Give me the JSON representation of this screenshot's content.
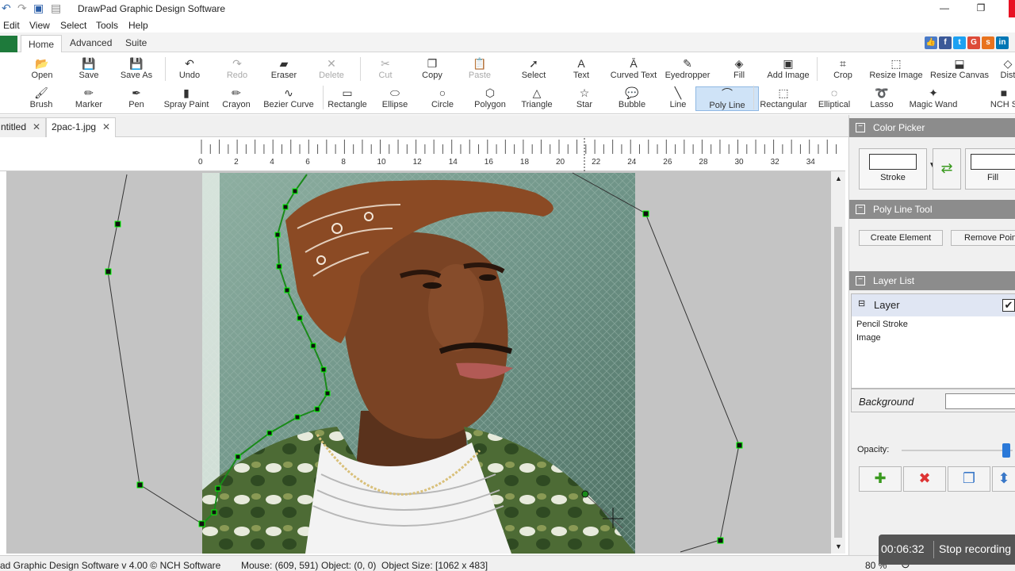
{
  "window": {
    "title": "DrawPad Graphic Design Software"
  },
  "menu": [
    "Edit",
    "View",
    "Select",
    "Tools",
    "Help"
  ],
  "ribbon_tabs": [
    "Home",
    "Advanced",
    "Suite"
  ],
  "tools_row1": [
    {
      "label": "Open",
      "icon": "folder-icon"
    },
    {
      "label": "Save",
      "icon": "save-icon"
    },
    {
      "label": "Save As",
      "icon": "save-as-icon"
    },
    {
      "label": "Undo",
      "icon": "undo-icon"
    },
    {
      "label": "Redo",
      "icon": "redo-icon"
    },
    {
      "label": "Eraser",
      "icon": "eraser-icon"
    },
    {
      "label": "Delete",
      "icon": "delete-icon"
    },
    {
      "label": "Cut",
      "icon": "cut-icon"
    },
    {
      "label": "Copy",
      "icon": "copy-icon"
    },
    {
      "label": "Paste",
      "icon": "paste-icon"
    },
    {
      "label": "Select",
      "icon": "cursor-icon"
    },
    {
      "label": "Text",
      "icon": "text-icon"
    },
    {
      "label": "Curved Text",
      "icon": "curved-text-icon"
    },
    {
      "label": "Eyedropper",
      "icon": "eyedropper-icon"
    },
    {
      "label": "Fill",
      "icon": "fill-icon"
    },
    {
      "label": "Add Image",
      "icon": "add-image-icon"
    },
    {
      "label": "Crop",
      "icon": "crop-icon"
    },
    {
      "label": "Resize Image",
      "icon": "resize-image-icon"
    },
    {
      "label": "Resize Canvas",
      "icon": "resize-canvas-icon"
    },
    {
      "label": "Dist",
      "icon": "distort-icon"
    }
  ],
  "tools_row2": [
    {
      "label": "Brush",
      "icon": "brush-icon"
    },
    {
      "label": "Marker",
      "icon": "marker-icon"
    },
    {
      "label": "Pen",
      "icon": "pen-icon"
    },
    {
      "label": "Spray Paint",
      "icon": "spray-paint-icon"
    },
    {
      "label": "Crayon",
      "icon": "crayon-icon"
    },
    {
      "label": "Bezier Curve",
      "icon": "bezier-icon"
    },
    {
      "label": "Rectangle",
      "icon": "rectangle-icon"
    },
    {
      "label": "Ellipse",
      "icon": "ellipse-icon"
    },
    {
      "label": "Circle",
      "icon": "circle-icon"
    },
    {
      "label": "Polygon",
      "icon": "polygon-icon"
    },
    {
      "label": "Triangle",
      "icon": "triangle-icon"
    },
    {
      "label": "Star",
      "icon": "star-icon"
    },
    {
      "label": "Bubble",
      "icon": "bubble-icon"
    },
    {
      "label": "Line",
      "icon": "line-icon"
    },
    {
      "label": "Poly Line",
      "icon": "polyline-icon"
    },
    {
      "label": "Rectangular",
      "icon": "rect-select-icon"
    },
    {
      "label": "Elliptical",
      "icon": "ellipse-select-icon"
    },
    {
      "label": "Lasso",
      "icon": "lasso-icon"
    },
    {
      "label": "Magic Wand",
      "icon": "magic-wand-icon"
    },
    {
      "label": "NCH S",
      "icon": "nch-icon"
    }
  ],
  "doc_tabs": [
    {
      "label": "ntitled"
    },
    {
      "label": "2pac-1.jpg"
    }
  ],
  "ruler_ticks": [
    "0",
    "2",
    "4",
    "6",
    "8",
    "10",
    "12",
    "14",
    "16",
    "18",
    "20",
    "22",
    "24",
    "26",
    "28",
    "30",
    "32",
    "34"
  ],
  "panel": {
    "color_picker": {
      "title": "Color Picker",
      "stroke_label": "Stroke",
      "fill_label": "Fill"
    },
    "poly_line": {
      "title": "Poly Line Tool",
      "create": "Create Element",
      "remove": "Remove Point"
    },
    "layer_list": {
      "title": "Layer List",
      "layer": "Layer",
      "items": [
        "Pencil Stroke",
        "Image"
      ],
      "background": "Background",
      "opacity": "Opacity:"
    }
  },
  "status": {
    "app": "ad Graphic Design Software v 4.00 © NCH Software",
    "mouse": "Mouse: (609, 591)",
    "object": "Object: (0, 0)",
    "size": "Object Size: [1062 x 483]",
    "zoom": "80 %"
  },
  "recording": {
    "time": "00:06:32",
    "label": "Stop recording"
  }
}
